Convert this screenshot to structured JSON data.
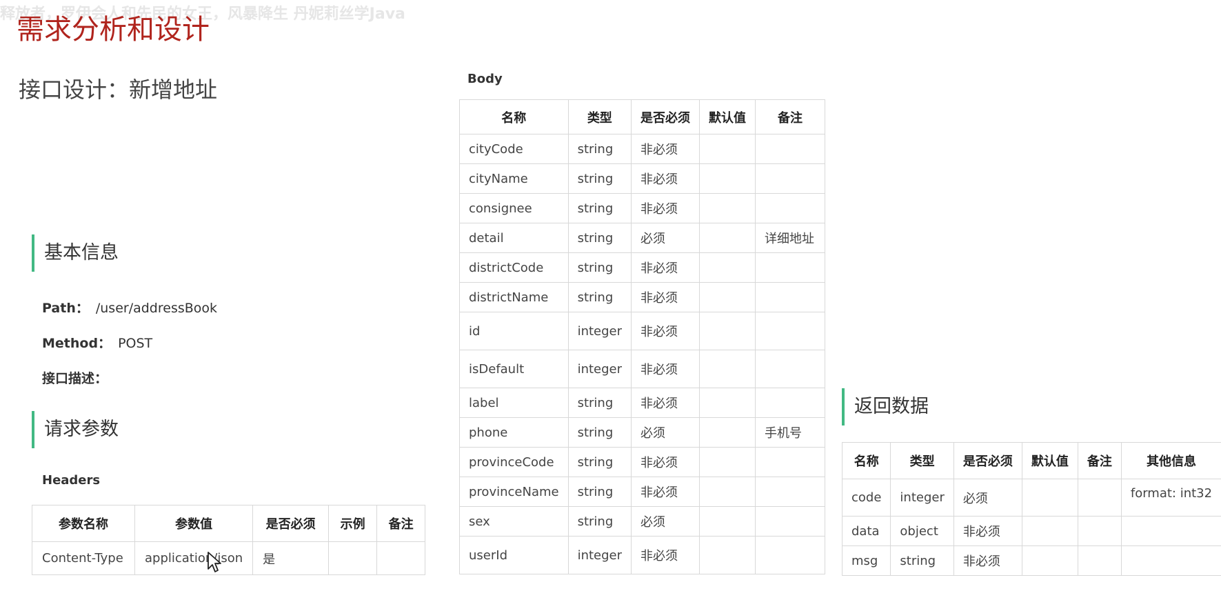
{
  "watermark": "释放者，罗伊会人和先民的女王，风暴降生 丹妮莉丝学Java",
  "title": "需求分析和设计",
  "subtitle": "接口设计：新增地址",
  "basic": {
    "heading": "基本信息",
    "path_label": "Path：",
    "path_value": "/user/addressBook",
    "method_label": "Method：",
    "method_value": "POST",
    "desc_label": "接口描述："
  },
  "request": {
    "heading": "请求参数",
    "headers_label": "Headers",
    "headers_columns": [
      "参数名称",
      "参数值",
      "是否必须",
      "示例",
      "备注"
    ],
    "headers_rows": [
      [
        "Content-Type",
        "application/json",
        "是",
        "",
        ""
      ]
    ]
  },
  "body": {
    "label": "Body",
    "columns": [
      "名称",
      "类型",
      "是否必须",
      "默认值",
      "备注"
    ],
    "rows": [
      [
        "cityCode",
        "string",
        "非必须",
        "",
        ""
      ],
      [
        "cityName",
        "string",
        "非必须",
        "",
        ""
      ],
      [
        "consignee",
        "string",
        "非必须",
        "",
        ""
      ],
      [
        "detail",
        "string",
        "必须",
        "",
        "详细地址"
      ],
      [
        "districtCode",
        "string",
        "非必须",
        "",
        ""
      ],
      [
        "districtName",
        "string",
        "非必须",
        "",
        ""
      ],
      [
        "id",
        "integer",
        "非必须",
        "",
        ""
      ],
      [
        "isDefault",
        "integer",
        "非必须",
        "",
        ""
      ],
      [
        "label",
        "string",
        "非必须",
        "",
        ""
      ],
      [
        "phone",
        "string",
        "必须",
        "",
        "手机号"
      ],
      [
        "provinceCode",
        "string",
        "非必须",
        "",
        ""
      ],
      [
        "provinceName",
        "string",
        "非必须",
        "",
        ""
      ],
      [
        "sex",
        "string",
        "必须",
        "",
        ""
      ],
      [
        "userId",
        "integer",
        "非必须",
        "",
        ""
      ]
    ]
  },
  "response": {
    "heading": "返回数据",
    "columns": [
      "名称",
      "类型",
      "是否必须",
      "默认值",
      "备注",
      "其他信息"
    ],
    "rows": [
      [
        "code",
        "integer",
        "必须",
        "",
        "",
        "format: int32"
      ],
      [
        "data",
        "object",
        "非必须",
        "",
        "",
        ""
      ],
      [
        "msg",
        "string",
        "非必须",
        "",
        "",
        ""
      ]
    ]
  },
  "colors": {
    "title": "#b0241d",
    "accent": "#42b983",
    "border": "#d8d8d8"
  },
  "icons": {
    "cursor": "mouse-pointer-icon"
  }
}
